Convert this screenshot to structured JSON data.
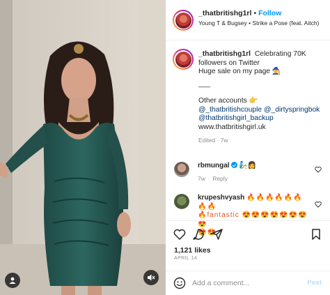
{
  "post": {
    "header": {
      "username": "_thatbritishg1rl",
      "separator": "•",
      "follow_label": "Follow",
      "audio": "Young T & Bugsey • Strike a Pose (feat. Aitch)"
    },
    "caption": {
      "username": "_thatbritishg1rl",
      "line1": "Celebrating 70K followers on Twitter",
      "line2": "Huge sale on my page 🧙",
      "divider": "___",
      "other_label": "Other accounts 👉",
      "mention1": "@_thatbritishcouple",
      "mention2": "@_dirtyspringbok",
      "mention3": "@thatbritishgirl_backup",
      "website": "www.thatbritishgirl.uk",
      "meta": "Edited · 7w"
    },
    "comments": [
      {
        "username": "rbmungal",
        "text": "🧞👩",
        "time": "7w",
        "reply_label": "Reply",
        "verified": true
      },
      {
        "username": "krupeshvyash",
        "text_line1": "🔥🔥🔥🔥🔥🔥🔥🔥",
        "text_line2": "🔥fantastic 😍😍😍😍😍😍😍😍",
        "text_line3": "😍😍"
      }
    ],
    "likes": "1,121 likes",
    "date": "APRIL 14",
    "add_comment": {
      "placeholder": "Add a comment...",
      "post_label": "Post"
    }
  },
  "icons": {
    "tag": "user-tag-icon",
    "mute": "speaker-muted-icon",
    "like": "heart-icon",
    "comment": "comment-bubble-icon",
    "share": "paper-plane-icon",
    "save": "bookmark-icon",
    "emoji": "smiley-icon"
  },
  "colors": {
    "accent": "#0095f6",
    "post_disabled": "#b2dffc",
    "muted_text": "#8e8e8e",
    "link": "#00376b"
  }
}
